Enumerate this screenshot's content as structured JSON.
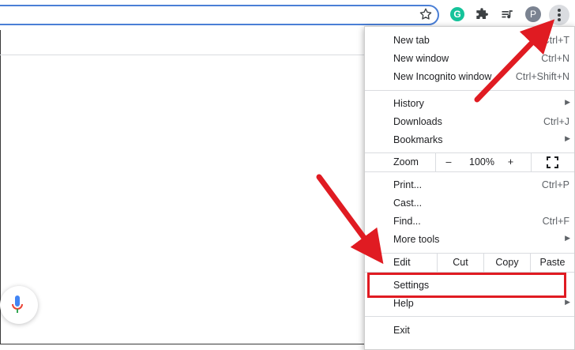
{
  "browser": {
    "avatar_initial": "P",
    "grammarly_letter": "G"
  },
  "menu": {
    "new_tab": {
      "label": "New tab",
      "shortcut": "Ctrl+T"
    },
    "new_window": {
      "label": "New window",
      "shortcut": "Ctrl+N"
    },
    "new_incognito": {
      "label": "New Incognito window",
      "shortcut": "Ctrl+Shift+N"
    },
    "history": {
      "label": "History"
    },
    "downloads": {
      "label": "Downloads",
      "shortcut": "Ctrl+J"
    },
    "bookmarks": {
      "label": "Bookmarks"
    },
    "zoom": {
      "label": "Zoom",
      "minus": "–",
      "value": "100%",
      "plus": "+"
    },
    "print": {
      "label": "Print...",
      "shortcut": "Ctrl+P"
    },
    "cast": {
      "label": "Cast..."
    },
    "find": {
      "label": "Find...",
      "shortcut": "Ctrl+F"
    },
    "more_tools": {
      "label": "More tools"
    },
    "edit": {
      "label": "Edit",
      "cut": "Cut",
      "copy": "Copy",
      "paste": "Paste"
    },
    "settings": {
      "label": "Settings"
    },
    "help": {
      "label": "Help"
    },
    "exit": {
      "label": "Exit"
    }
  },
  "colors": {
    "annotation_red": "#e01b22",
    "omnibox_border": "#4a7fd6",
    "grammarly_green": "#15c39a"
  }
}
